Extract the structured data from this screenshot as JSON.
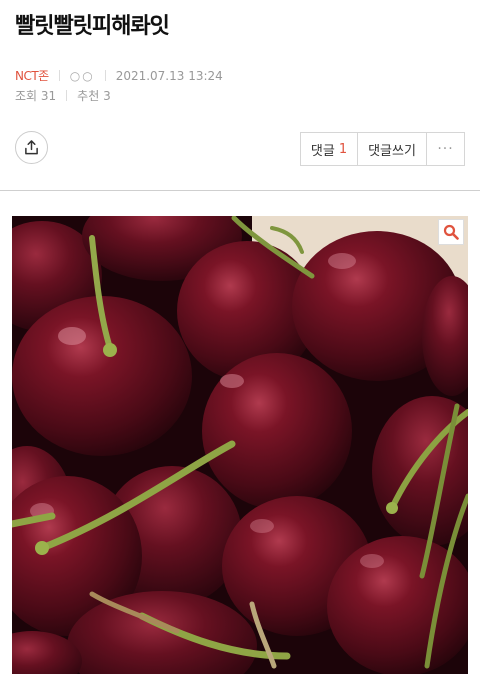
{
  "post": {
    "title": "빨릿빨릿피해롸잇",
    "board": "NCT존",
    "author": "○○",
    "date": "2021.07.13 13:24",
    "views_label": "조회 31",
    "likes_label": "추천 3"
  },
  "toolbar": {
    "comments_label": "댓글",
    "comments_count": "1",
    "write_comment_label": "댓글쓰기",
    "more_label": "···"
  },
  "image": {
    "subject": "cherries",
    "zoom_icon": "magnifier-icon"
  },
  "colors": {
    "accent": "#e0533e",
    "cherry_dark": "#3d0710",
    "cherry_mid": "#6b0f1e",
    "cherry_highlight": "#a83246",
    "stem": "#8aa140"
  }
}
